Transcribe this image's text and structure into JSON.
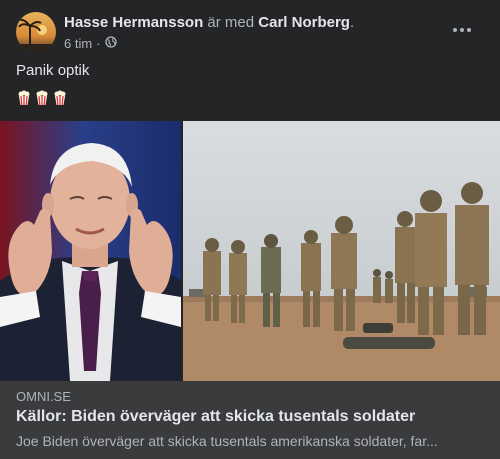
{
  "post": {
    "author": "Hasse Hermansson",
    "with_text": "är med",
    "tagged": "Carl Norberg",
    "tagged_suffix": ".",
    "time": "6 tim",
    "separator": "·",
    "privacy_icon": "globe-icon",
    "more_icon": "more-options-icon",
    "text": "Panik optik",
    "emojis": [
      "popcorn",
      "popcorn",
      "popcorn"
    ]
  },
  "link": {
    "domain": "OMNI.SE",
    "title": "Källor: Biden överväger att skicka tusentals soldater",
    "description": "Joe Biden överväger att skicka tusentals amerikanska soldater, far..."
  },
  "colors": {
    "background": "#242526",
    "link_card": "#3a3b3c",
    "primary_text": "#e4e6eb",
    "secondary_text": "#b0b3b8"
  }
}
